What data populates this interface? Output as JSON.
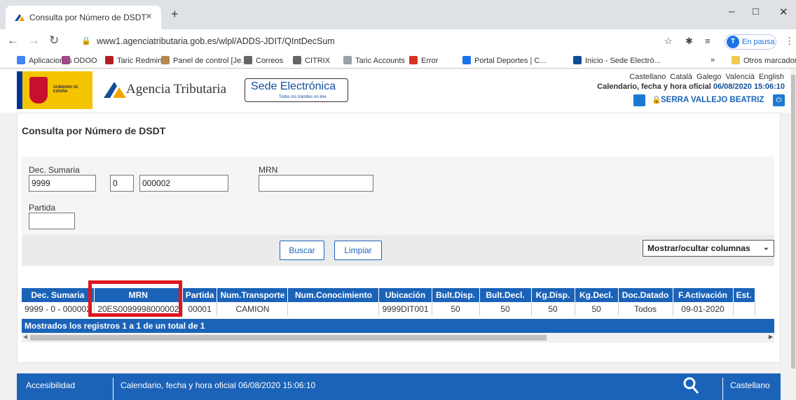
{
  "browser": {
    "tab_title": "Consulta por Número de DSDT",
    "tab_close": "×",
    "new_tab": "+",
    "url": "www1.agenciatributaria.gob.es/wlpl/ADDS-JDIT/QIntDecSum",
    "profile_status": "En pausa",
    "window_controls": [
      "–",
      "□",
      "✕"
    ]
  },
  "bookmarks": [
    {
      "label": "Aplicaciones",
      "color": "#4285f4"
    },
    {
      "label": "ODOO",
      "color": "#a24689"
    },
    {
      "label": "Taric Redmine",
      "color": "#b32024"
    },
    {
      "label": "Panel de control [Je...",
      "color": "#b08850"
    },
    {
      "label": "Correos",
      "color": "#666666"
    },
    {
      "label": "CITRIX",
      "color": "#666666"
    },
    {
      "label": "Taric Accounts",
      "color": "#9aa0a6"
    },
    {
      "label": "Error",
      "color": "#d93025"
    },
    {
      "label": "Portal Deportes | C...",
      "color": "#1a73e8"
    },
    {
      "label": "Inicio - Sede Electró...",
      "color": "#104e9a"
    }
  ],
  "bookmarks_more": "»",
  "bookmarks_other": "Otros marcadores",
  "header": {
    "gov_text": "GOBIERNO DE ESPAÑA",
    "agency": "Agencia Tributaria",
    "sede_title": "Sede Electrónica",
    "sede_sub": "Todos los trámites on line",
    "languages": [
      "Castellano",
      "Català",
      "Galego",
      "Valencià",
      "English"
    ],
    "calendar_label": "Calendario, fecha y hora oficial",
    "calendar_value": "06/08/2020 15:06:10",
    "user_name": "SERRA VALLEJO BEATRIZ"
  },
  "page": {
    "title": "Consulta por Número de DSDT",
    "form": {
      "dec_sumaria_label": "Dec. Sumaria",
      "dec_sumaria_values": [
        "9999",
        "0",
        "000002"
      ],
      "mrn_label": "MRN",
      "mrn_value": "",
      "partida_label": "Partida",
      "partida_value": ""
    },
    "buttons": {
      "search": "Buscar",
      "clear": "Limpiar"
    },
    "column_toggle": "Mostrar/ocultar columnas"
  },
  "table": {
    "headers": [
      "Dec. Sumaria",
      "MRN",
      "Partida",
      "Num.Transporte",
      "Num.Conocimiento",
      "Ubicación",
      "Bult.Disp.",
      "Bult.Decl.",
      "Kg.Disp.",
      "Kg.Decl.",
      "Doc.Datado",
      "F.Activación",
      "Est."
    ],
    "rows": [
      [
        "9999 - 0 - 000002",
        "20ES0099998000002",
        "00001",
        "CAMION",
        "",
        "9999DIT001",
        "50",
        "50",
        "50",
        "50",
        "Todos",
        "09-01-2020",
        ""
      ]
    ],
    "footer": "Mostrados los registros 1 a 1 de un total de 1"
  },
  "footer": {
    "accessibility": "Accesibilidad",
    "calendar": "Calendario, fecha y hora oficial 06/08/2020 15:06:10",
    "language": "Castellano"
  }
}
